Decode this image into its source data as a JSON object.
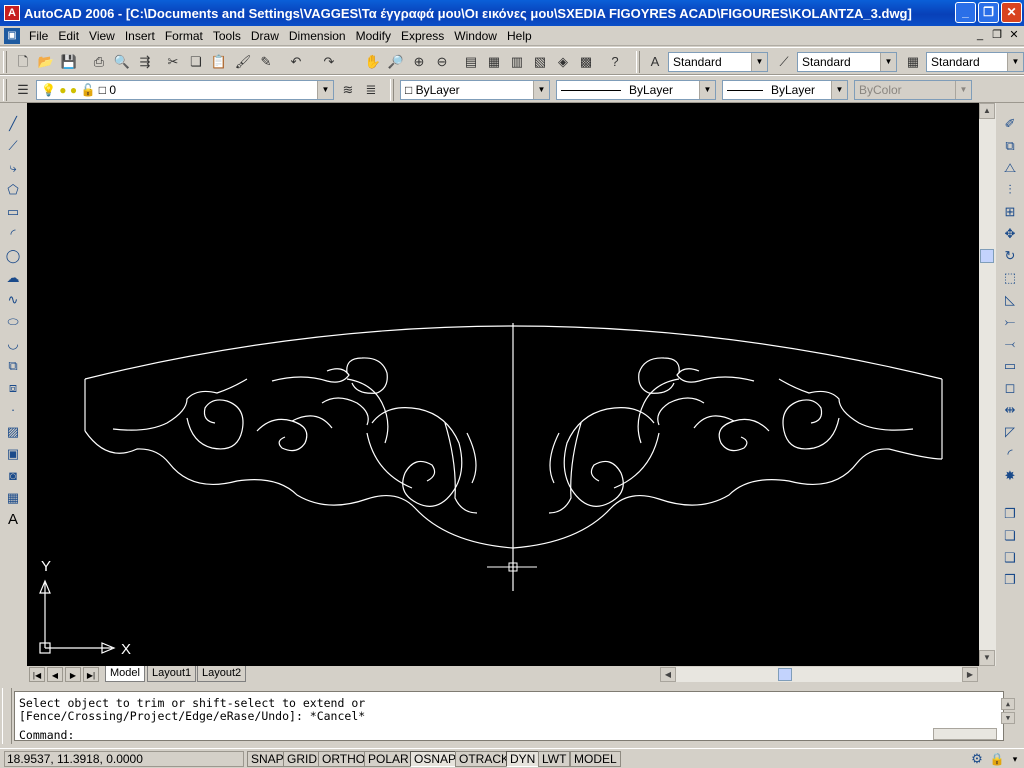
{
  "window": {
    "title": "AutoCAD 2006 - [C:\\Documents and Settings\\VAGGES\\Τα έγγραφά μου\\Οι εικόνες μου\\SXEDIA FIGOYRES ACAD\\FIGOURES\\KOLANTZA_3.dwg]"
  },
  "menu": [
    "File",
    "Edit",
    "View",
    "Insert",
    "Format",
    "Tools",
    "Draw",
    "Dimension",
    "Modify",
    "Express",
    "Window",
    "Help"
  ],
  "toolbar": {
    "text_style": "Standard",
    "dim_style": "Standard",
    "table_style": "Standard",
    "layer": "0",
    "color": "ByLayer",
    "linetype": "ByLayer",
    "lineweight": "ByLayer",
    "plotstyle": "ByColor"
  },
  "ucs": {
    "x_label": "X",
    "y_label": "Y"
  },
  "tabs": [
    "Model",
    "Layout1",
    "Layout2"
  ],
  "command": {
    "line1": "Select object to trim or shift-select to extend or",
    "line2": "[Fence/Crossing/Project/Edge/eRase/Undo]: *Cancel*",
    "prompt": "Command:"
  },
  "status": {
    "coords": "18.9537, 11.3918, 0.0000",
    "buttons": [
      {
        "label": "SNAP",
        "on": false
      },
      {
        "label": "GRID",
        "on": false
      },
      {
        "label": "ORTHO",
        "on": false
      },
      {
        "label": "POLAR",
        "on": false
      },
      {
        "label": "OSNAP",
        "on": true
      },
      {
        "label": "OTRACK",
        "on": false
      },
      {
        "label": "DYN",
        "on": true
      },
      {
        "label": "LWT",
        "on": false
      },
      {
        "label": "MODEL",
        "on": false
      }
    ]
  },
  "colors": {
    "canvas": "#000000",
    "drawing": "#ffffff",
    "title_bar": "#0a5fd8"
  }
}
